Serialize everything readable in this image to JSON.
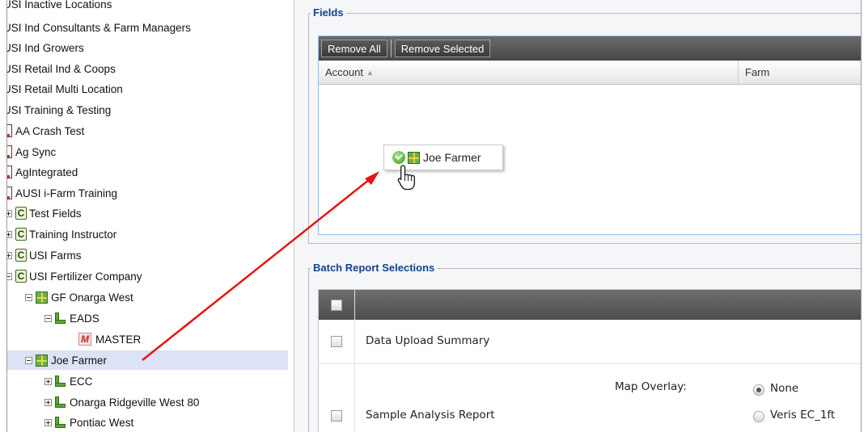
{
  "tree": {
    "items": [
      {
        "label": "USI Inactive Locations"
      },
      {
        "label": "USI Ind Consultants & Farm Managers"
      },
      {
        "label": "USI Ind Growers"
      },
      {
        "label": "USI Retail Ind & Coops"
      },
      {
        "label": "USI Retail Multi Location"
      },
      {
        "label": "USI Training & Testing"
      },
      {
        "label": "AA Crash Test"
      },
      {
        "label": "Ag Sync"
      },
      {
        "label": "AgIntegrated"
      },
      {
        "label": "AUSI i-Farm Training"
      },
      {
        "label": "Test Fields"
      },
      {
        "label": "Training Instructor"
      },
      {
        "label": "USI Farms"
      },
      {
        "label": "USI Fertilizer Company"
      },
      {
        "label": "GF Onarga West"
      },
      {
        "label": "EADS"
      },
      {
        "label": "MASTER"
      },
      {
        "label": "Joe Farmer",
        "selected": true
      },
      {
        "label": "ECC"
      },
      {
        "label": "Onarga Ridgeville West 80"
      },
      {
        "label": "Pontiac West"
      }
    ]
  },
  "fields_panel": {
    "legend": "Fields",
    "toolbar": {
      "remove_all": "Remove All",
      "remove_selected": "Remove Selected"
    },
    "columns": {
      "account": "Account",
      "farm": "Farm"
    },
    "drag_proxy_label": "Joe Farmer"
  },
  "batch_panel": {
    "legend": "Batch Report Selections",
    "rows": {
      "data_upload": "Data Upload Summary",
      "sample_analysis": "Sample Analysis Report"
    },
    "map_overlay": {
      "label": "Map Overlay:",
      "options": [
        "None",
        "Veris EC_1ft"
      ],
      "selected": "None"
    }
  },
  "annotation": {
    "arrow_color": "#e8140f"
  },
  "icons": {
    "account": "account-icon",
    "company": "company-c-icon",
    "farm": "farm-grid-icon",
    "field": "field-icon",
    "management": "management-m-icon",
    "drop_ok": "check-circle-icon",
    "cursor": "hand-pointer-icon"
  }
}
